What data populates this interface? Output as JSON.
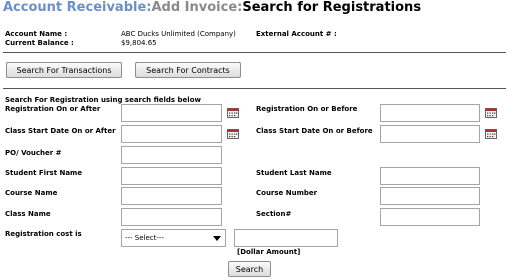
{
  "header": {
    "breadcrumb_part1": "Account Receivable:",
    "breadcrumb_part2": "Add Invoice:",
    "page_title": "Search for Registrations"
  },
  "account": {
    "name_label": "Account Name :",
    "name_value": "ABC Ducks Unlimited  (Company)",
    "external_label": "External Account # :",
    "balance_label": "Current Balance :",
    "balance_value": "$9,804.65"
  },
  "buttons": {
    "search_transactions": "Search For Transactions",
    "search_contracts": "Search For Contracts",
    "search": "Search"
  },
  "form": {
    "instruction": "Search For Registration using search fields below",
    "registration_on_after": "Registration On or After",
    "registration_on_before": "Registration On or Before",
    "class_start_after": "Class Start Date On or After",
    "class_start_before": "Class Start Date On or Before",
    "po_voucher": "PO/ Voucher #",
    "student_first": "Student First Name",
    "student_last": "Student Last Name",
    "course_name": "Course Name",
    "course_number": "Course Number",
    "class_name": "Class Name",
    "section": "Section#",
    "registration_cost": "Registration cost is",
    "cost_select_value": "--- Select---",
    "dollar_amount": "[Dollar Amount]"
  },
  "icons": {
    "calendar": "calendar-icon",
    "dropdown": "chevron-down-icon"
  },
  "colors": {
    "breadcrumb_part1": "#6b8fc9",
    "breadcrumb_part2": "#8a8a8a"
  }
}
